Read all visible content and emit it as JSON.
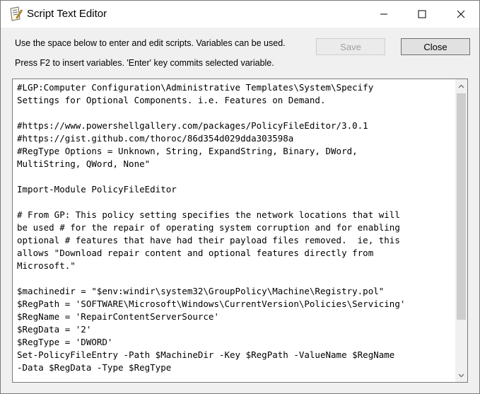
{
  "window": {
    "title": "Script Text Editor",
    "icon": "script-editor-icon"
  },
  "instructions": {
    "line1": "Use the space below to enter and edit scripts. Variables can be used.",
    "line2": "Press F2 to insert variables. 'Enter' key commits selected variable."
  },
  "buttons": {
    "save_label": "Save",
    "close_label": "Close"
  },
  "editor": {
    "content": "#LGP:Computer Configuration\\Administrative Templates\\System\\Specify\nSettings for Optional Components. i.e. Features on Demand.\n\n#https://www.powershellgallery.com/packages/PolicyFileEditor/3.0.1\n#https://gist.github.com/thoroc/86d354d029dda303598a\n#RegType Options = Unknown, String, ExpandString, Binary, DWord,\nMultiString, QWord, None\"\n\nImport-Module PolicyFileEditor\n\n# From GP: This policy setting specifies the network locations that will\nbe used # for the repair of operating system corruption and for enabling\noptional # features that have had their payload files removed.  ie, this\nallows \"Download repair content and optional features directly from\nMicrosoft.\"\n\n$machinedir = \"$env:windir\\system32\\GroupPolicy\\Machine\\Registry.pol\"\n$RegPath = 'SOFTWARE\\Microsoft\\Windows\\CurrentVersion\\Policies\\Servicing'\n$RegName = 'RepairContentServerSource'\n$RegData = '2'\n$RegType = 'DWORD'\nSet-PolicyFileEntry -Path $MachineDir -Key $RegPath -ValueName $RegName\n-Data $RegData -Type $RegType"
  }
}
